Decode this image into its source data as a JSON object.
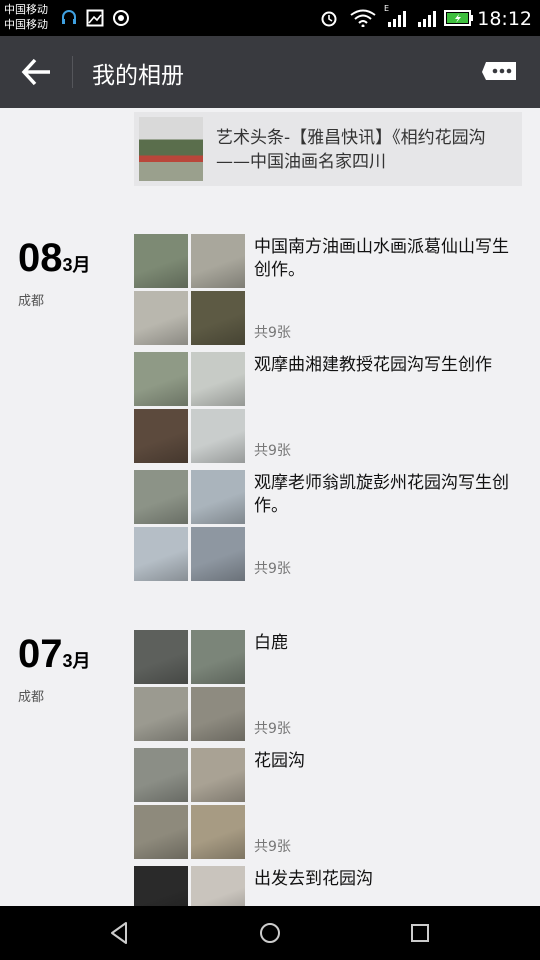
{
  "status_bar": {
    "carrier_1": "中国移动",
    "carrier_2": "中国移动",
    "time": "18:12",
    "network_label": "E",
    "icons": [
      "headset-icon",
      "image-icon",
      "sync-icon",
      "alarm-icon",
      "wifi-icon",
      "signal-icon",
      "signal-icon",
      "battery-icon"
    ]
  },
  "title_bar": {
    "title": "我的相册",
    "back_icon": "arrow-left-icon",
    "action_icon": "message-icon"
  },
  "shared_link": {
    "text": "艺术头条-【雅昌快讯】《相约花园沟——中国油画名家四川"
  },
  "days": [
    {
      "day": "08",
      "month": "3月",
      "location": "成都",
      "posts": [
        {
          "text": "中国南方油画山水画派葛仙山写生创作。",
          "count": "共9张",
          "thumb_colors": [
            "#7d8a74",
            "#a9a79c",
            "#b9b7ae",
            "#5d5a44"
          ]
        },
        {
          "text": "观摩曲湘建教授花园沟写生创作",
          "count": "共9张",
          "thumb_colors": [
            "#8f9a86",
            "#c7cbc6",
            "#5c4a3d",
            "#c9cdcc"
          ]
        },
        {
          "text": "观摩老师翁凯旋彭州花园沟写生创作。",
          "count": "共9张",
          "thumb_colors": [
            "#8c9387",
            "#aab4bc",
            "#b5bec6",
            "#8e97a1"
          ]
        }
      ]
    },
    {
      "day": "07",
      "month": "3月",
      "location": "成都",
      "posts": [
        {
          "text": "白鹿",
          "count": "共9张",
          "thumb_colors": [
            "#5d605c",
            "#7b8579",
            "#9b9a90",
            "#8e8b80"
          ]
        },
        {
          "text": "花园沟",
          "count": "共9张",
          "thumb_colors": [
            "#8b8e86",
            "#a9a294",
            "#8e8a7c",
            "#a79b83"
          ]
        },
        {
          "text": "出发去到花园沟",
          "count": "",
          "thumb_colors": [
            "#2a2a2a",
            "#c9c4bd",
            "#000000",
            "#000000"
          ]
        }
      ]
    }
  ],
  "nav_bar": {
    "icons": [
      "back-triangle-icon",
      "home-circle-icon",
      "recents-square-icon"
    ]
  }
}
